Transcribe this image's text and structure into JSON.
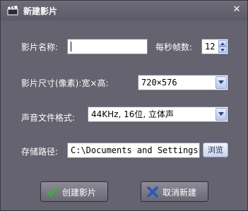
{
  "window": {
    "title": "新建影片",
    "icon": "clapperboard-icon",
    "close_icon": "close-icon"
  },
  "form": {
    "name_label": "影片名称:",
    "name_value": "",
    "fps_label": "每秒帧数:",
    "fps_value": "12",
    "size_label": "影片尺寸(像素):宽×高:",
    "size_value": "720×576",
    "audio_label": "声音文件格式:",
    "audio_value": "44KHz, 16位, 立体声",
    "path_label": "存储路径:",
    "path_value": "C:\\Documents and Settings",
    "browse_label": "浏览"
  },
  "buttons": {
    "create_label": "创建影片",
    "cancel_label": "取消新建"
  },
  "colors": {
    "background": "#64636f",
    "create_icon": "#3fae3a",
    "cancel_icon": "#2a57b8"
  }
}
